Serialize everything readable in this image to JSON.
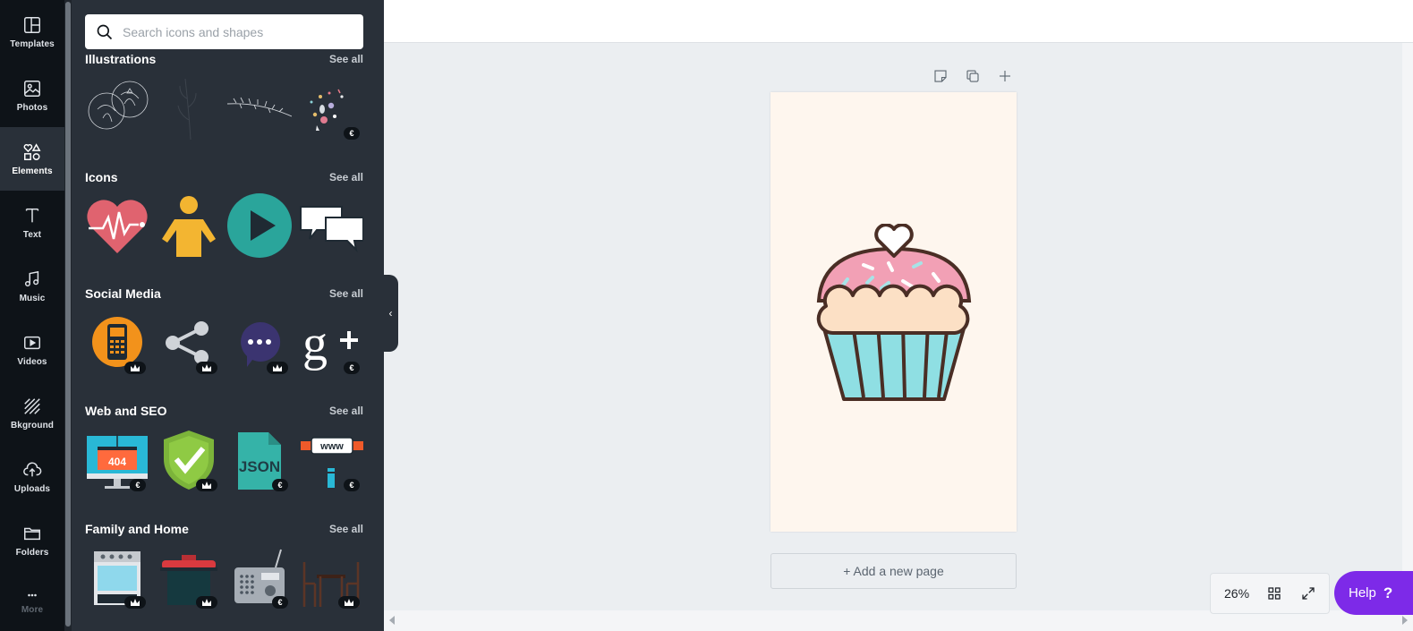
{
  "rail": {
    "items": [
      {
        "label": "Templates",
        "icon": "templates-icon"
      },
      {
        "label": "Photos",
        "icon": "photos-icon"
      },
      {
        "label": "Elements",
        "icon": "elements-icon",
        "active": true
      },
      {
        "label": "Text",
        "icon": "text-icon"
      },
      {
        "label": "Music",
        "icon": "music-icon"
      },
      {
        "label": "Videos",
        "icon": "videos-icon"
      },
      {
        "label": "Bkground",
        "icon": "background-icon"
      },
      {
        "label": "Uploads",
        "icon": "uploads-icon"
      },
      {
        "label": "Folders",
        "icon": "folders-icon"
      },
      {
        "label": "More",
        "icon": "more-icon"
      }
    ]
  },
  "search": {
    "placeholder": "Search icons and shapes",
    "value": ""
  },
  "sections": [
    {
      "title": "Illustrations",
      "see_all": "See all",
      "items": [
        "cabbage-illustration",
        "branch-illustration",
        "twig-illustration",
        "confetti-illustration"
      ],
      "badges": [
        "",
        "",
        "",
        "€"
      ]
    },
    {
      "title": "Icons",
      "see_all": "See all",
      "items": [
        "heart-pulse-icon",
        "person-icon",
        "play-icon",
        "chat-bubbles-icon"
      ],
      "badges": [
        "",
        "",
        "",
        ""
      ]
    },
    {
      "title": "Social Media",
      "see_all": "See all",
      "items": [
        "phone-circle-icon",
        "share-icon",
        "message-dots-icon",
        "google-plus-icon"
      ],
      "badges": [
        "crown",
        "crown",
        "crown",
        "€"
      ]
    },
    {
      "title": "Web and SEO",
      "see_all": "See all",
      "items": [
        "error-404-monitor",
        "security-shield",
        "json-file",
        "www-signboard"
      ],
      "badges": [
        "€",
        "crown",
        "€",
        "€"
      ],
      "labels": {
        "error": "404",
        "json": "JSON",
        "www": "www"
      }
    },
    {
      "title": "Family and Home",
      "see_all": "See all",
      "items": [
        "oven",
        "bbq-grill",
        "radio",
        "table-chairs"
      ],
      "badges": [
        "crown",
        "crown",
        "€",
        "crown"
      ]
    }
  ],
  "canvas": {
    "add_page_label": "+ Add a new page",
    "page_background": "#fef6ee"
  },
  "zoom": {
    "value": "26%"
  },
  "help": {
    "label": "Help",
    "icon_text": "?"
  },
  "colors": {
    "accent": "#7d2ae8",
    "rail": "#0e1318",
    "panel": "#293039"
  }
}
